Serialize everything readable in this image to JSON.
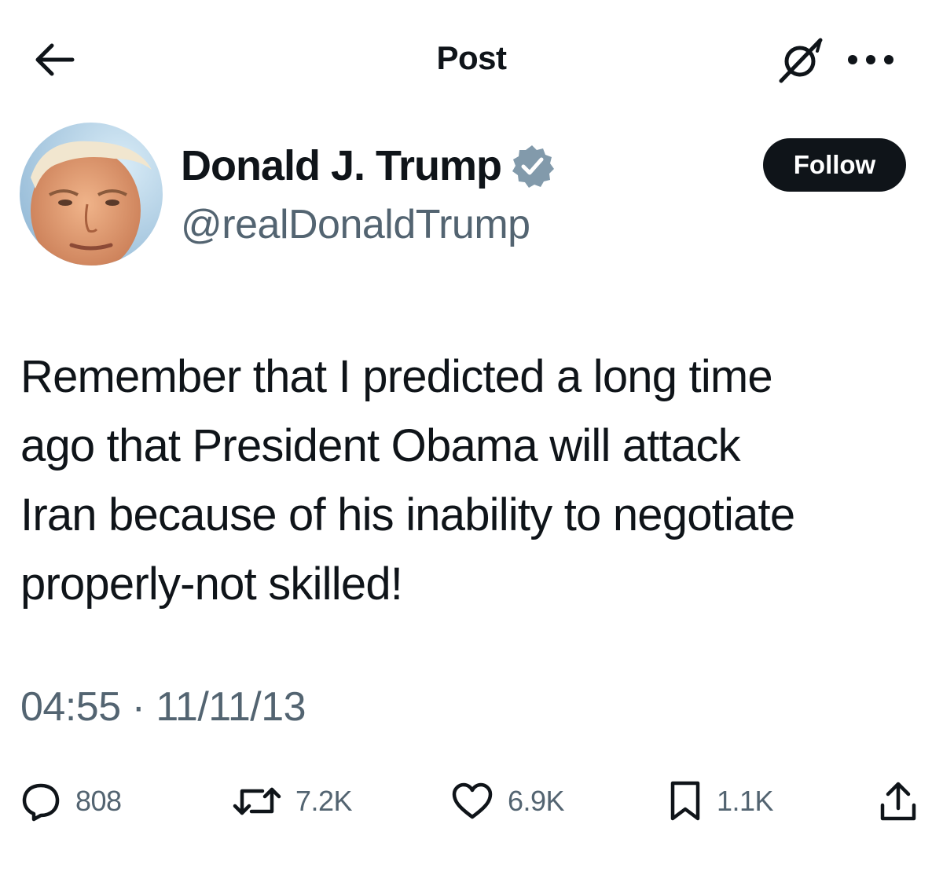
{
  "header": {
    "title": "Post",
    "back_icon": "arrow-left-icon",
    "grok_icon": "grok-icon",
    "more_icon": "more-horizontal-icon"
  },
  "author": {
    "name": "Donald J. Trump",
    "handle": "@realDonaldTrump",
    "verified": true,
    "verified_color": "#829aab",
    "follow_label": "Follow"
  },
  "post": {
    "text": "Remember that I predicted a long time\nago that President Obama will attack\nIran because of his inability to negotiate\nproperly-not skilled!",
    "timestamp": "04:55 · 11/11/13"
  },
  "actions": {
    "replies": "808",
    "reposts": "7.2K",
    "likes": "6.9K",
    "bookmarks": "1.1K",
    "share_icon": "share-icon"
  },
  "colors": {
    "text": "#0f1419",
    "secondary": "#536471",
    "follow_bg": "#0f1419"
  }
}
